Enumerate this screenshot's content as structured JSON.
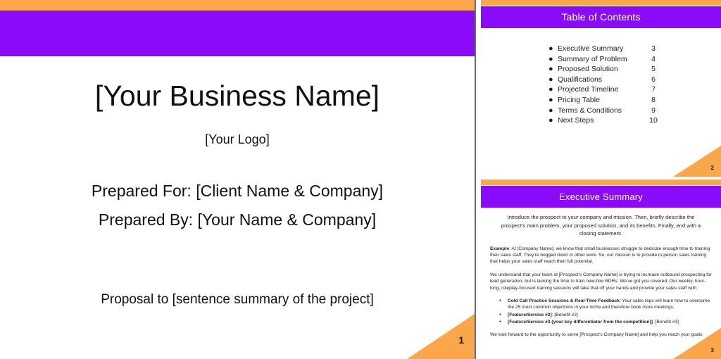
{
  "document": {
    "pages": [
      {
        "id": "cover",
        "page_number": "1",
        "title": "[Your Business Name]",
        "logo": "[Your Logo]",
        "prepared_for": "Prepared For: [Client Name & Company]",
        "prepared_by": "Prepared By: [Your Name & Company]",
        "proposal_line": "Proposal to [sentence summary of the project]"
      },
      {
        "id": "table-of-contents",
        "page_number": "2",
        "header": "Table of Contents",
        "entries": [
          {
            "bullet": "●",
            "label": "Executive Summary",
            "page": "3"
          },
          {
            "bullet": "●",
            "label": "Summary of Problem",
            "page": "4"
          },
          {
            "bullet": "●",
            "label": "Proposed Solution",
            "page": "5"
          },
          {
            "bullet": "●",
            "label": "Qualifications",
            "page": "6"
          },
          {
            "bullet": "●",
            "label": "Projected Timeline",
            "page": "7"
          },
          {
            "bullet": "●",
            "label": "Pricing Table",
            "page": "8"
          },
          {
            "bullet": "●",
            "label": "Terms & Conditions",
            "page": "9"
          },
          {
            "bullet": "●",
            "label": "Next Steps",
            "page": "10"
          }
        ]
      },
      {
        "id": "executive-summary",
        "page_number": "3",
        "header": "Executive Summary",
        "intro": "Introduce the prospect to your company and mission. Then, briefly describe the prospect's main problem, your proposed solution, and its benefits. Finally, end with a closing statement.",
        "example_label": "Example",
        "example_text": ": At [Company Name], we know that small businesses struggle to dedicate enough time to training their sales staff. They're bogged down in other work. So, our mission is to provide in-person sales training that helps your sales staff reach their full potential.",
        "understanding_para": "We understand that your team at [Prospect's Company Name] is trying to increase outbound prospecting for lead generation, but is lacking the time to train new-hire BDRs. We've got you covered. Our weekly, hour-long, roleplay-focused training sessions will take that off your hands and provide your sales staff with:",
        "benefits": [
          {
            "bold": "Cold Call Practice Sessions & Real-Time Feedback",
            "rest": ": Your sales reps will learn how to overcome the 25 most common objections in your niche and therefore book more meetings."
          },
          {
            "bold": "[Feature/Service #2]",
            "rest": ": [Benefit #2]"
          },
          {
            "bold": "[Feature/Service #3 (your key differentiator from the competition)]",
            "rest": ": [Benefit #3]"
          }
        ],
        "closing": "We look forward to the opportunity to serve [Prospect's Company Name] and help you reach your goals."
      }
    ]
  },
  "theme": {
    "accent_orange": "#f9a74a",
    "accent_purple": "#8a0afa",
    "header_text": "#ffffff",
    "body_text": "#1c1c1c"
  }
}
